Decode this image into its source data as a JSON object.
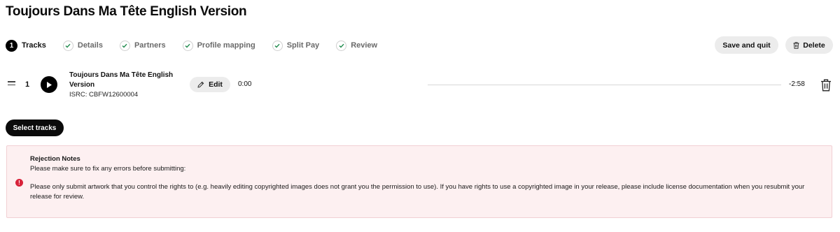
{
  "page": {
    "title": "Toujours Dans Ma Tête English Version"
  },
  "steps": [
    {
      "label": "Tracks",
      "number": "1",
      "state": "active"
    },
    {
      "label": "Details",
      "state": "done"
    },
    {
      "label": "Partners",
      "state": "done"
    },
    {
      "label": "Profile mapping",
      "state": "done"
    },
    {
      "label": "Split Pay",
      "state": "done"
    },
    {
      "label": "Review",
      "state": "done"
    }
  ],
  "header_actions": {
    "save_label": "Save and quit",
    "delete_label": "Delete"
  },
  "track": {
    "index": "1",
    "title": "Toujours Dans Ma Tête English Version",
    "isrc": "ISRC: CBFW12600004",
    "edit_label": "Edit",
    "time_current": "0:00",
    "time_remaining": "-2:58",
    "progress": 0
  },
  "select_tracks_label": "Select tracks",
  "rejection": {
    "title": "Rejection Notes",
    "subtitle": "Please make sure to fix any errors before submitting:",
    "message": "Please only submit artwork that you control the rights to (e.g. heavily editing copyrighted images does not grant you the permission to use). If you have rights to use a copyrighted image in your release, please include license documentation when you resubmit your release for review.",
    "icon_glyph": "!"
  },
  "colors": {
    "accent": "#000000",
    "check": "#1f8a4c",
    "error": "#d8223a",
    "notes_bg": "#fdf0f1"
  },
  "icons": {
    "check": "check-icon",
    "play": "play-icon",
    "pencil": "pencil-icon",
    "trash": "trash-icon",
    "drag": "drag-handle-icon",
    "alert": "alert-icon"
  }
}
